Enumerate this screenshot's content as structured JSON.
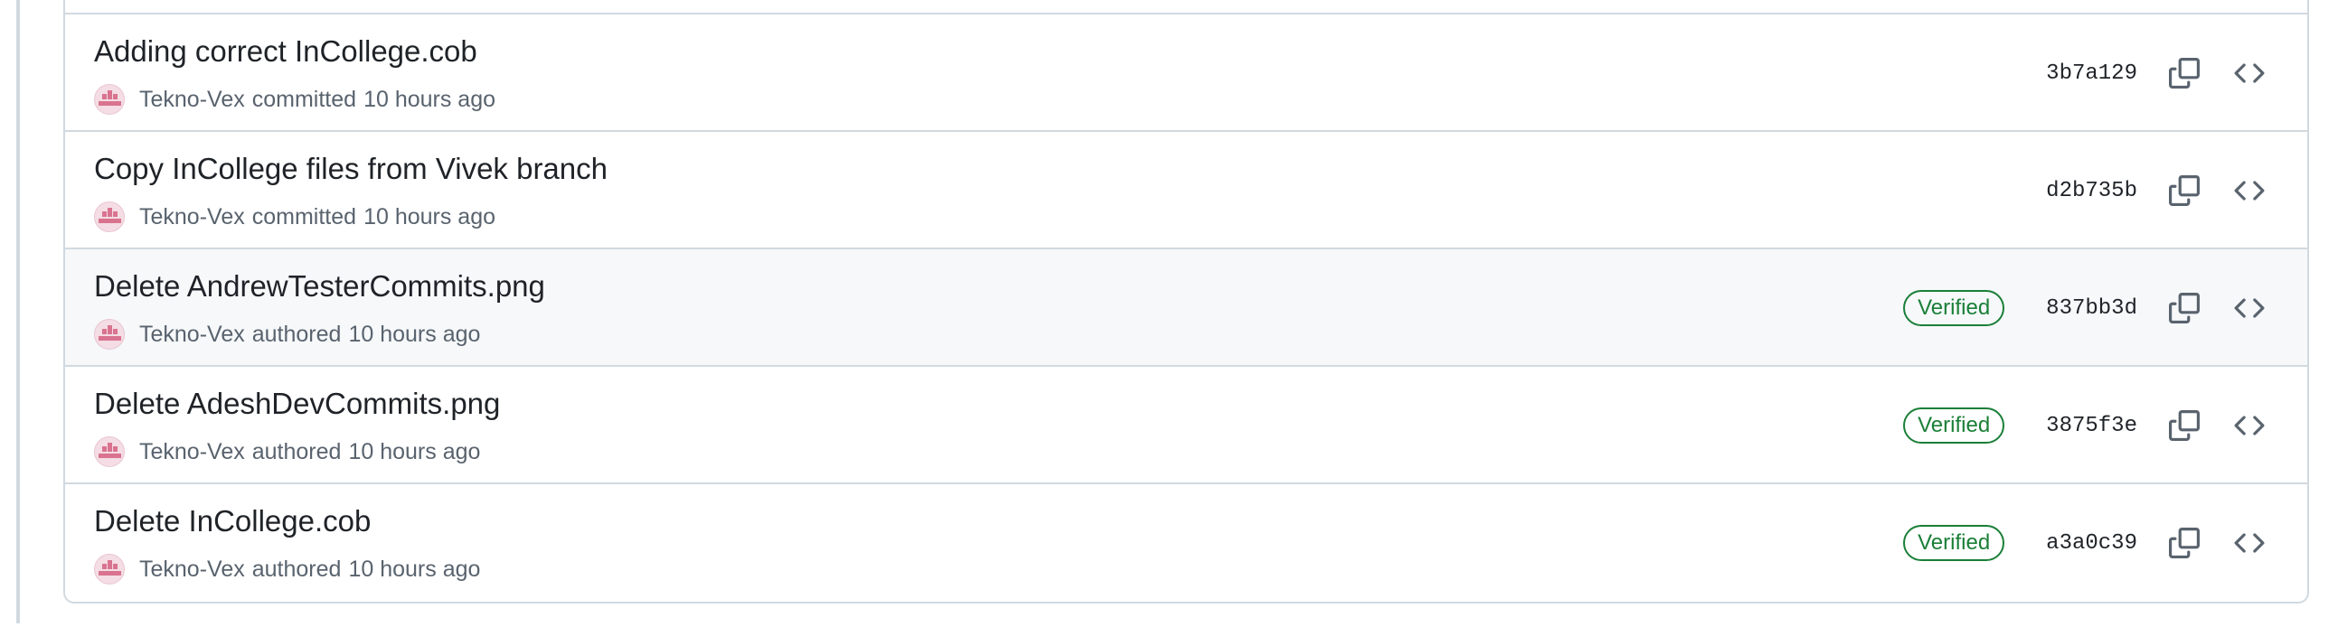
{
  "commits": [
    {
      "title": "Adding correct InCollege.cob",
      "author": "Tekno-Vex",
      "action": "committed",
      "time": "10 hours ago",
      "verified": false,
      "sha": "3b7a129"
    },
    {
      "title": "Copy InCollege files from Vivek branch",
      "author": "Tekno-Vex",
      "action": "committed",
      "time": "10 hours ago",
      "verified": false,
      "sha": "d2b735b"
    },
    {
      "title": "Delete AndrewTesterCommits.png",
      "author": "Tekno-Vex",
      "action": "authored",
      "time": "10 hours ago",
      "verified": true,
      "verified_label": "Verified",
      "sha": "837bb3d",
      "highlighted": true
    },
    {
      "title": "Delete AdeshDevCommits.png",
      "author": "Tekno-Vex",
      "action": "authored",
      "time": "10 hours ago",
      "verified": true,
      "verified_label": "Verified",
      "sha": "3875f3e"
    },
    {
      "title": "Delete InCollege.cob",
      "author": "Tekno-Vex",
      "action": "authored",
      "time": "10 hours ago",
      "verified": true,
      "verified_label": "Verified",
      "sha": "a3a0c39"
    }
  ],
  "icons": {
    "copy": "copy-icon",
    "browse": "code-icon",
    "avatar": "identicon"
  },
  "colors": {
    "verified": "#1a7f37",
    "border": "#d1d9e0",
    "muted_text": "#59636e",
    "avatar": "#d9738f",
    "highlight_bg": "#f6f8fa"
  }
}
